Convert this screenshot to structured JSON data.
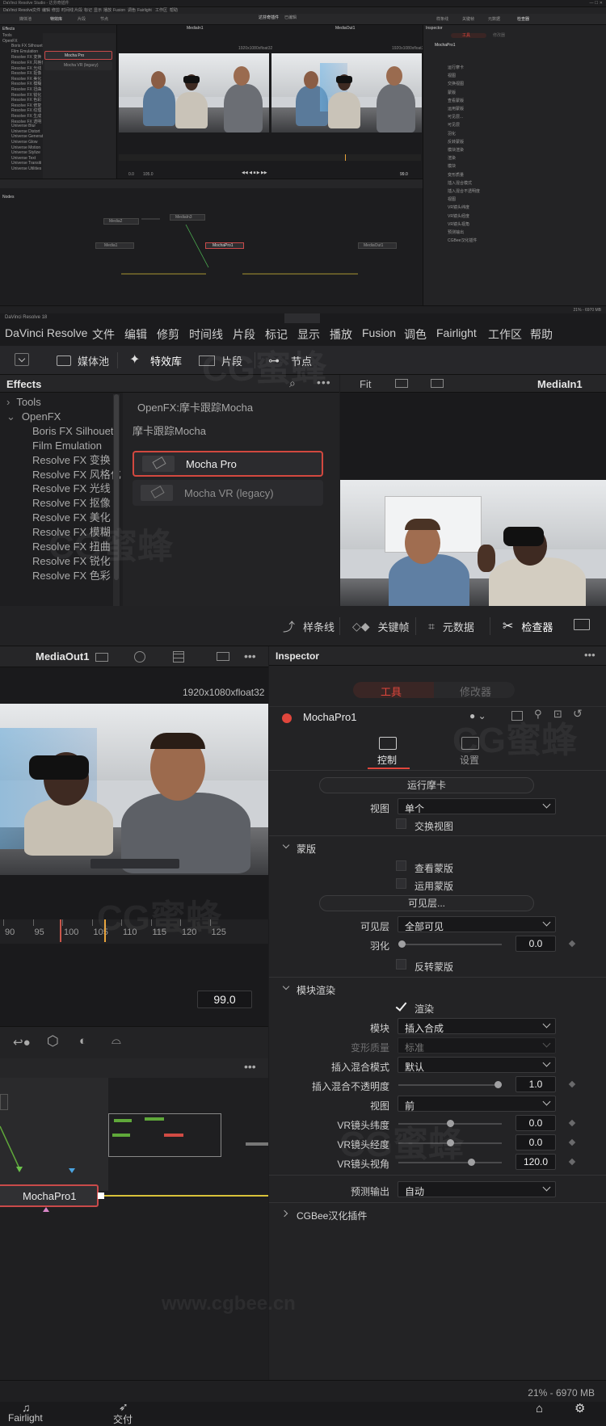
{
  "overview": {
    "window_title": "DaVinci Resolve Studio - 达芬奇插件",
    "menu": [
      "DaVinci Resolve",
      "文件",
      "编辑",
      "修剪",
      "时间线",
      "片段",
      "标记",
      "显示",
      "播放",
      "Fusion",
      "调色",
      "Fairlight",
      "工作区",
      "帮助"
    ],
    "toolbar_left": [
      "媒体池",
      "特效库",
      "片段",
      "节点"
    ],
    "toolbar_center": "达芬奇插件",
    "toolbar_center_sub": "已编辑",
    "toolbar_right": [
      "样条线",
      "关键帧",
      "元数据",
      "检查器"
    ],
    "effects_header": "Effects",
    "effects_tree": [
      "Tools",
      "OpenFX",
      "Boris FX Silhouet",
      "Film Emulation",
      "Resolve FX 变换",
      "Resolve FX 风格化",
      "Resolve FX 光线",
      "Resolve FX 抠像",
      "Resolve FX 美化",
      "Resolve FX 模糊",
      "Resolve FX 扭曲",
      "Resolve FX 锐化",
      "Resolve FX 色彩",
      "Resolve FX 修复",
      "Resolve FX 纹理",
      "Resolve FX 生成",
      "Resolve FX 透明",
      "Universe Blur",
      "Universe Distort",
      "Universe Generat",
      "Universe Glow",
      "Universe Motion",
      "Universe Stylize",
      "Universe Text",
      "Universe Transiti",
      "Universe Utilities"
    ],
    "viewer_left": "MediaIn1",
    "viewer_right": "MediaOut1",
    "viewer_res": "1920x1080xfloat32",
    "timeline_start": "0.0",
    "timeline_end": "105.0",
    "frame": "99.0",
    "nodes_label": "Nodes",
    "nodes": [
      "Media2",
      "MediaIn3",
      "Media1",
      "MochaPro1",
      "MediaOut1"
    ],
    "inspector_label": "Inspector",
    "status": "21% - 6970 MB"
  },
  "zoom1": {
    "app_name": "DaVinci Resolve 18",
    "menu": [
      "DaVinci Resolve",
      "文件",
      "编辑",
      "修剪",
      "时间线",
      "片段",
      "标记",
      "显示",
      "播放",
      "Fusion",
      "调色",
      "Fairlight",
      "工作区",
      "帮助"
    ],
    "nav": {
      "media_pool": "媒体池",
      "effects": "特效库",
      "clip": "片段",
      "nodes": "节点"
    },
    "effects_title": "Effects",
    "tree": [
      "Tools",
      "OpenFX",
      "Boris FX Silhouet",
      "Film Emulation",
      "Resolve FX 变换",
      "Resolve FX 风格化",
      "Resolve FX 光线",
      "Resolve FX 抠像",
      "Resolve FX 美化",
      "Resolve FX 模糊",
      "Resolve FX 扭曲",
      "Resolve FX 锐化",
      "Resolve FX 色彩"
    ],
    "breadcrumb": "OpenFX:摩卡跟踪Mocha",
    "category": "摩卡跟踪Mocha",
    "items": [
      "Mocha Pro",
      "Mocha VR (legacy)"
    ],
    "viewer_fit": "Fit",
    "viewer_name": "MediaIn1"
  },
  "zoom2": {
    "toolbar": {
      "spline": "样条线",
      "keyframes": "关键帧",
      "metadata": "元数据",
      "inspector": "检查器"
    },
    "viewer_name": "MediaOut1",
    "viewer_res": "1920x1080xfloat32",
    "ruler": [
      "90",
      "95",
      "100",
      "105",
      "110",
      "115",
      "120",
      "125"
    ],
    "frame": "99.0",
    "node_name": "MochaPro1",
    "inspector_title": "Inspector",
    "tabs": {
      "tools": "工具",
      "modifiers": "修改器"
    },
    "tool_name": "MochaPro1",
    "subtabs": {
      "control": "控制",
      "settings": "设置"
    },
    "run_button": "运行摩卡",
    "view_label": "视图",
    "view_value": "单个",
    "swap_view": "交换视图",
    "mask_section": "蒙版",
    "view_mask": "查看蒙版",
    "apply_mask": "运用蒙版",
    "visible_layers_button": "可见层...",
    "visible_layers_label": "可见层",
    "visible_layers_value": "全部可见",
    "feather_label": "羽化",
    "feather_value": "0.0",
    "feather_level": 0.0,
    "invert_mask": "反转蒙版",
    "render_section": "模块渲染",
    "render": "渲染",
    "module_label": "模块",
    "module_value": "插入合成",
    "warp_quality_label": "变形质量",
    "warp_quality_value": "标准",
    "blend_mode_label": "插入混合模式",
    "blend_mode_value": "默认",
    "blend_opacity_label": "插入混合不透明度",
    "blend_opacity_value": "1.0",
    "blend_opacity_level": 1.0,
    "view2_label": "视图",
    "view2_value": "前",
    "vr_lat_label": "VR镜头纬度",
    "vr_lat_value": "0.0",
    "vr_lon_label": "VR镜头经度",
    "vr_lon_value": "0.0",
    "vr_fov_label": "VR镜头视角",
    "vr_fov_value": "120.0",
    "preview_label": "预测输出",
    "preview_value": "自动",
    "cgbee_section": "CGBee汉化插件",
    "status": "21% - 6970 MB",
    "bottom_nav": {
      "fairlight": "Fairlight",
      "deliver": "交付"
    }
  },
  "watermark": "CG蜜蜂",
  "watermark_url": "www.cgbee.cn",
  "colors": {
    "accent_red": "#e0463c",
    "node_outline": "#c94a4a",
    "yellow_line": "#d8c23a",
    "playhead": "#e8a33a"
  }
}
